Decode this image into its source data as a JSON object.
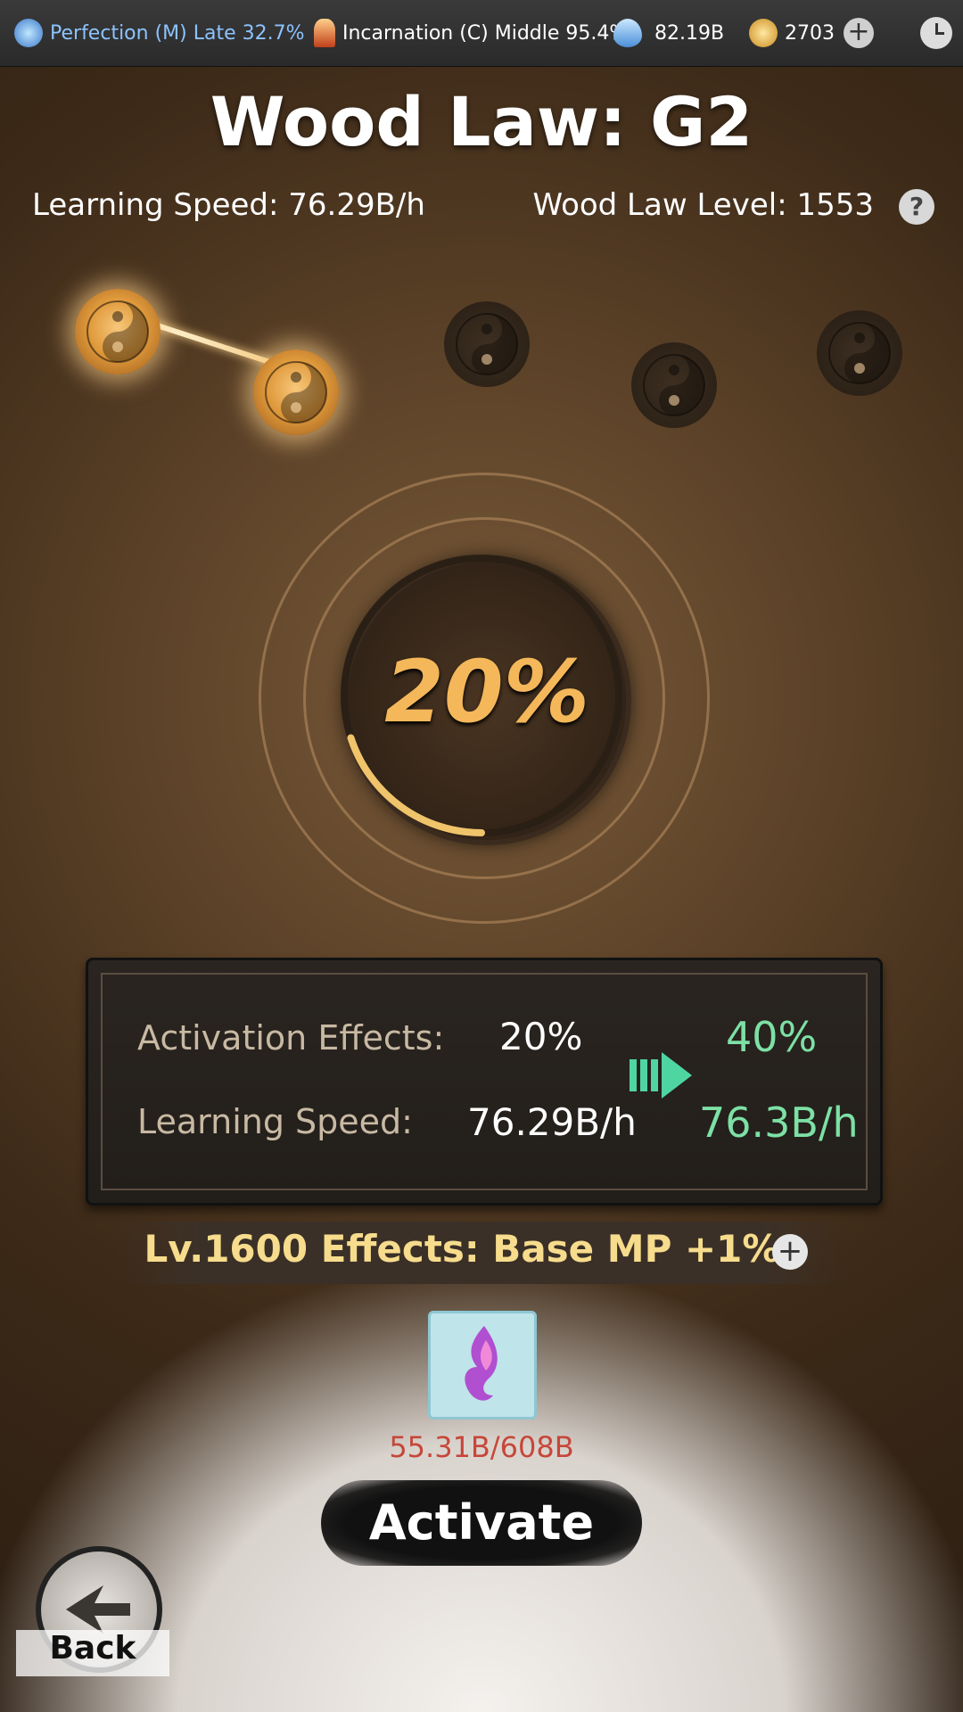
{
  "topbar": {
    "realm1": "Perfection (M) Late 32.7%",
    "realm2": "Incarnation (C) Middle 95.4%",
    "crystal": "82.19B",
    "currency": "2703"
  },
  "header": {
    "title": "Wood Law: G2",
    "learning_speed": "Learning Speed: 76.29B/h",
    "law_level": "Wood Law Level: 1553"
  },
  "progress": {
    "center_text": "20%",
    "value_percent": 20,
    "nodes_total": 5,
    "nodes_active": 2
  },
  "effects_panel": {
    "activation_label": "Activation Effects:",
    "activation_current": "20%",
    "activation_next": "40%",
    "speed_label": "Learning Speed:",
    "speed_current": "76.29B/h",
    "speed_next": "76.3B/h"
  },
  "level_effect": {
    "text": "Lv.1600 Effects: Base MP +1%"
  },
  "cost": {
    "text": "55.31B/608B"
  },
  "buttons": {
    "activate": "Activate",
    "back": "Back"
  },
  "colors": {
    "accent_gold": "#f4b75a",
    "next_value_green": "#7de0a5",
    "cost_red": "#c6473a"
  }
}
